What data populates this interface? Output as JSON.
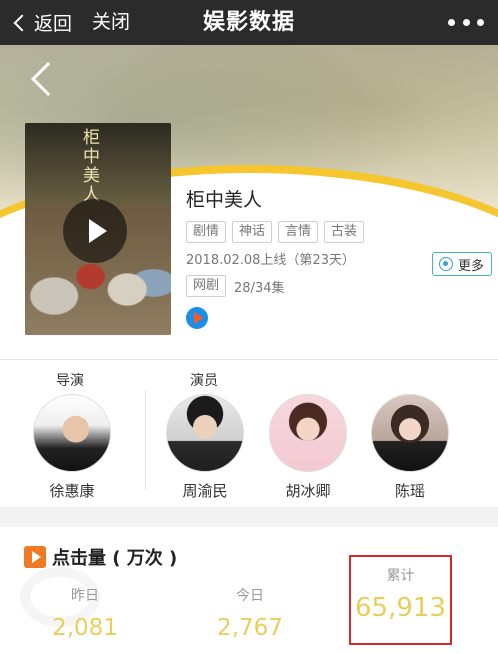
{
  "topbar": {
    "back_label": "返回",
    "close_label": "关闭",
    "title": "娱影数据"
  },
  "drama": {
    "title": "柜中美人",
    "poster_title": "柜中美人",
    "tags": [
      "剧情",
      "神话",
      "言情",
      "古装"
    ],
    "release": "2018.02.08上线（第23天）",
    "type_tag": "网剧",
    "episodes": "28/34集",
    "more_label": "更多"
  },
  "cast": {
    "director_label": "导演",
    "actor_label": "演员",
    "people": [
      {
        "name": "徐惠康",
        "role": "director"
      },
      {
        "name": "周渝民",
        "role": "actor"
      },
      {
        "name": "胡冰卿",
        "role": "actor"
      },
      {
        "name": "陈瑶",
        "role": "actor"
      }
    ]
  },
  "stats": {
    "title": "点击量 ( 万次 )",
    "yesterday_label": "昨日",
    "yesterday_value": "2,081",
    "today_label": "今日",
    "today_value": "2,767",
    "total_label": "累计",
    "total_value": "65,913"
  },
  "colors": {
    "topbar": "#2b2b2b",
    "accent_yellow": "#f5c62e",
    "value_yellow": "#e8cf5c",
    "highlight_red": "#d9262a",
    "stat_icon": "#f07a23"
  }
}
